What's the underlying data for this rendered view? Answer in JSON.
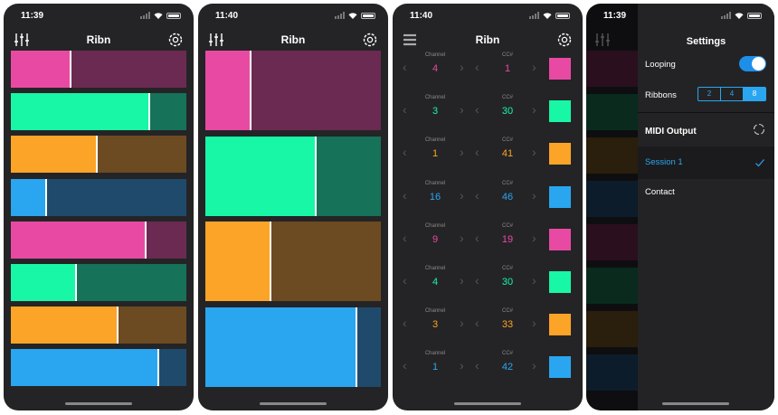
{
  "colors": {
    "pink": "#e84aa3",
    "pink_dim": "#6b2a51",
    "green": "#18f7a6",
    "green_dim": "#167259",
    "orange": "#fca427",
    "orange_dim": "#6c4a22",
    "blue": "#2aa6f0",
    "blue_dim": "#1f4a6b"
  },
  "screen1": {
    "time": "11:39",
    "title": "Ribn",
    "ribbons": [
      {
        "color": "pink",
        "level": 0.34
      },
      {
        "color": "green",
        "level": 0.79
      },
      {
        "color": "orange",
        "level": 0.49
      },
      {
        "color": "blue",
        "level": 0.2
      },
      {
        "color": "pink",
        "level": 0.77
      },
      {
        "color": "green",
        "level": 0.37
      },
      {
        "color": "orange",
        "level": 0.61
      },
      {
        "color": "blue",
        "level": 0.84
      }
    ]
  },
  "screen2": {
    "time": "11:40",
    "title": "Ribn",
    "ribbons": [
      {
        "color": "pink",
        "level": 0.26
      },
      {
        "color": "green",
        "level": 0.63
      },
      {
        "color": "orange",
        "level": 0.37
      },
      {
        "color": "blue",
        "level": 0.86
      }
    ]
  },
  "screen3": {
    "time": "11:40",
    "title": "Ribn",
    "channel_label": "Channel",
    "cc_label": "CC#",
    "rows": [
      {
        "channel": "4",
        "cc": "1",
        "color": "pink"
      },
      {
        "channel": "3",
        "cc": "30",
        "color": "green"
      },
      {
        "channel": "1",
        "cc": "41",
        "color": "orange"
      },
      {
        "channel": "16",
        "cc": "46",
        "color": "blue"
      },
      {
        "channel": "9",
        "cc": "19",
        "color": "pink"
      },
      {
        "channel": "4",
        "cc": "30",
        "color": "green"
      },
      {
        "channel": "3",
        "cc": "33",
        "color": "orange"
      },
      {
        "channel": "1",
        "cc": "42",
        "color": "blue"
      }
    ]
  },
  "screen4": {
    "time": "11:39",
    "title": "Settings",
    "looping_label": "Looping",
    "looping_on": true,
    "ribbons_label": "Ribbons",
    "ribbon_options": [
      "2",
      "4",
      "8"
    ],
    "ribbon_selected": "8",
    "midi_output_label": "MIDI Output",
    "session_label": "Session 1",
    "contact_label": "Contact"
  }
}
